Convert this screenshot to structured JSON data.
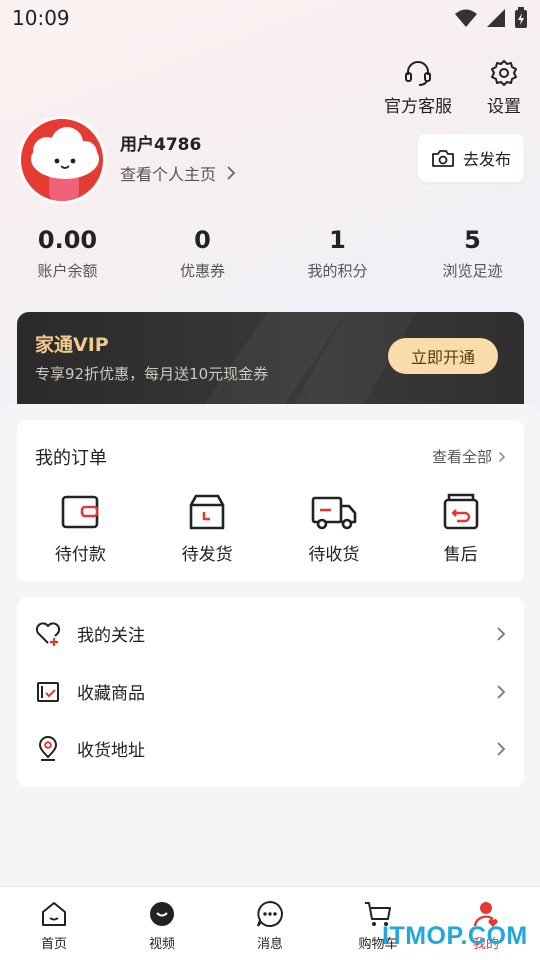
{
  "status_bar": {
    "time": "10:09"
  },
  "header": {
    "service_label": "官方客服",
    "settings_label": "设置"
  },
  "profile": {
    "username": "用户4786",
    "homepage_link": "查看个人主页",
    "publish_label": "去发布"
  },
  "stats": [
    {
      "value": "0.00",
      "label": "账户余额"
    },
    {
      "value": "0",
      "label": "优惠券"
    },
    {
      "value": "1",
      "label": "我的积分"
    },
    {
      "value": "5",
      "label": "浏览足迹"
    }
  ],
  "vip": {
    "title": "家通VIP",
    "subtitle": "专享92折优惠，每月送10元现金券",
    "button": "立即开通"
  },
  "orders": {
    "title": "我的订单",
    "view_all": "查看全部",
    "items": [
      {
        "label": "待付款",
        "icon": "wallet-icon"
      },
      {
        "label": "待发货",
        "icon": "box-icon"
      },
      {
        "label": "待收货",
        "icon": "truck-icon"
      },
      {
        "label": "售后",
        "icon": "return-icon"
      }
    ]
  },
  "menu": [
    {
      "label": "我的关注",
      "icon": "heart-plus-icon"
    },
    {
      "label": "收藏商品",
      "icon": "collect-icon"
    },
    {
      "label": "收货地址",
      "icon": "location-icon"
    }
  ],
  "tabbar": [
    {
      "label": "首页",
      "icon": "home-icon"
    },
    {
      "label": "视频",
      "icon": "video-icon"
    },
    {
      "label": "消息",
      "icon": "message-icon"
    },
    {
      "label": "购物车",
      "icon": "cart-icon"
    },
    {
      "label": "我的",
      "icon": "profile-icon",
      "active": true
    }
  ],
  "watermark": "ITMOP.COM",
  "colors": {
    "accent": "#e23a2f",
    "vip_gold": "#f1c98f",
    "vip_button": "#f8dcaa",
    "watermark": "#1fa8e0"
  }
}
